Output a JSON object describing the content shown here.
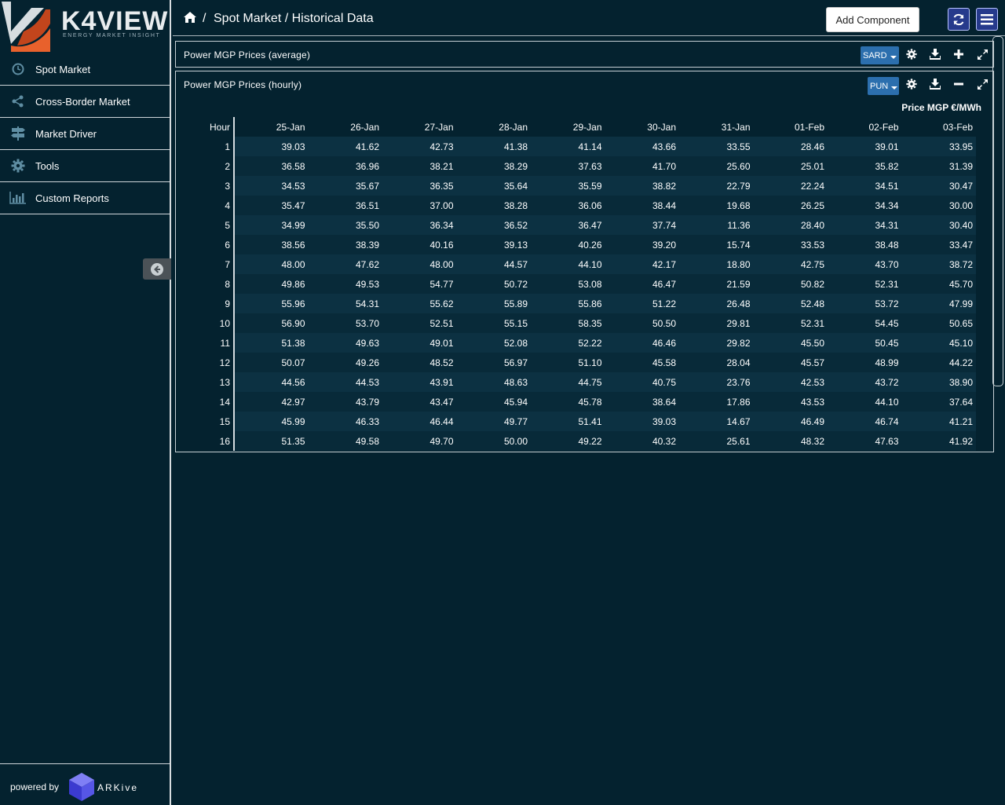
{
  "brand": {
    "logo_text": "K4VIEW",
    "tagline": "ENERGY MARKET INSIGHT"
  },
  "sidebar": {
    "items": [
      {
        "label": "Spot Market",
        "icon": "clock-icon"
      },
      {
        "label": "Cross-Border Market",
        "icon": "share-icon"
      },
      {
        "label": "Market Driver",
        "icon": "signpost-icon"
      },
      {
        "label": "Tools",
        "icon": "gear-icon"
      },
      {
        "label": "Custom Reports",
        "icon": "bar-chart-icon"
      }
    ],
    "footer": {
      "powered_by": "powered by",
      "partner": "ARKive"
    }
  },
  "header": {
    "breadcrumb": "Spot Market / Historical Data",
    "separator": "/",
    "add_component": "Add Component"
  },
  "panels": {
    "average": {
      "title": "Power MGP Prices (average)",
      "selector": "SARD"
    },
    "hourly": {
      "title": "Power MGP Prices (hourly)",
      "selector": "PUN"
    }
  },
  "table": {
    "unit_label": "Price MGP €/MWh",
    "hour_header": "Hour",
    "columns": [
      "25-Jan",
      "26-Jan",
      "27-Jan",
      "28-Jan",
      "29-Jan",
      "30-Jan",
      "31-Jan",
      "01-Feb",
      "02-Feb",
      "03-Feb"
    ],
    "rows": [
      {
        "hour": "1",
        "values": [
          "39.03",
          "41.62",
          "42.73",
          "41.38",
          "41.14",
          "43.66",
          "33.55",
          "28.46",
          "39.01",
          "33.95"
        ]
      },
      {
        "hour": "2",
        "values": [
          "36.58",
          "36.96",
          "38.21",
          "38.29",
          "37.63",
          "41.70",
          "25.60",
          "25.01",
          "35.82",
          "31.39"
        ]
      },
      {
        "hour": "3",
        "values": [
          "34.53",
          "35.67",
          "36.35",
          "35.64",
          "35.59",
          "38.82",
          "22.79",
          "22.24",
          "34.51",
          "30.47"
        ]
      },
      {
        "hour": "4",
        "values": [
          "35.47",
          "36.51",
          "37.00",
          "38.28",
          "36.06",
          "38.44",
          "19.68",
          "26.25",
          "34.34",
          "30.00"
        ]
      },
      {
        "hour": "5",
        "values": [
          "34.99",
          "35.50",
          "36.34",
          "36.52",
          "36.47",
          "37.74",
          "11.36",
          "28.40",
          "34.31",
          "30.40"
        ]
      },
      {
        "hour": "6",
        "values": [
          "38.56",
          "38.39",
          "40.16",
          "39.13",
          "40.26",
          "39.20",
          "15.74",
          "33.53",
          "38.48",
          "33.47"
        ]
      },
      {
        "hour": "7",
        "values": [
          "48.00",
          "47.62",
          "48.00",
          "44.57",
          "44.10",
          "42.17",
          "18.80",
          "42.75",
          "43.70",
          "38.72"
        ]
      },
      {
        "hour": "8",
        "values": [
          "49.86",
          "49.53",
          "54.77",
          "50.72",
          "53.08",
          "46.47",
          "21.59",
          "50.82",
          "52.31",
          "45.70"
        ]
      },
      {
        "hour": "9",
        "values": [
          "55.96",
          "54.31",
          "55.62",
          "55.89",
          "55.86",
          "51.22",
          "26.48",
          "52.48",
          "53.72",
          "47.99"
        ]
      },
      {
        "hour": "10",
        "values": [
          "56.90",
          "53.70",
          "52.51",
          "55.15",
          "58.35",
          "50.50",
          "29.81",
          "52.31",
          "54.45",
          "50.65"
        ]
      },
      {
        "hour": "11",
        "values": [
          "51.38",
          "49.63",
          "49.01",
          "52.08",
          "52.22",
          "46.46",
          "29.82",
          "45.50",
          "50.45",
          "45.10"
        ]
      },
      {
        "hour": "12",
        "values": [
          "50.07",
          "49.26",
          "48.52",
          "56.97",
          "51.10",
          "45.58",
          "28.04",
          "45.57",
          "48.99",
          "44.22"
        ]
      },
      {
        "hour": "13",
        "values": [
          "44.56",
          "44.53",
          "43.91",
          "48.63",
          "44.75",
          "40.75",
          "23.76",
          "42.53",
          "43.72",
          "38.90"
        ]
      },
      {
        "hour": "14",
        "values": [
          "42.97",
          "43.79",
          "43.47",
          "45.94",
          "45.78",
          "38.64",
          "17.86",
          "43.53",
          "44.10",
          "37.64"
        ]
      },
      {
        "hour": "15",
        "values": [
          "45.99",
          "46.33",
          "46.44",
          "49.77",
          "51.41",
          "39.03",
          "14.67",
          "46.49",
          "46.74",
          "41.21"
        ]
      },
      {
        "hour": "16",
        "values": [
          "51.35",
          "49.58",
          "49.70",
          "50.00",
          "49.22",
          "40.32",
          "25.61",
          "48.32",
          "47.63",
          "41.92"
        ]
      }
    ]
  },
  "colors": {
    "background": "#04222f",
    "row_alt": "#0c3142",
    "selector": "#2c6fae",
    "header_button": "#263a8c",
    "logo_orange": "#e8612c"
  }
}
